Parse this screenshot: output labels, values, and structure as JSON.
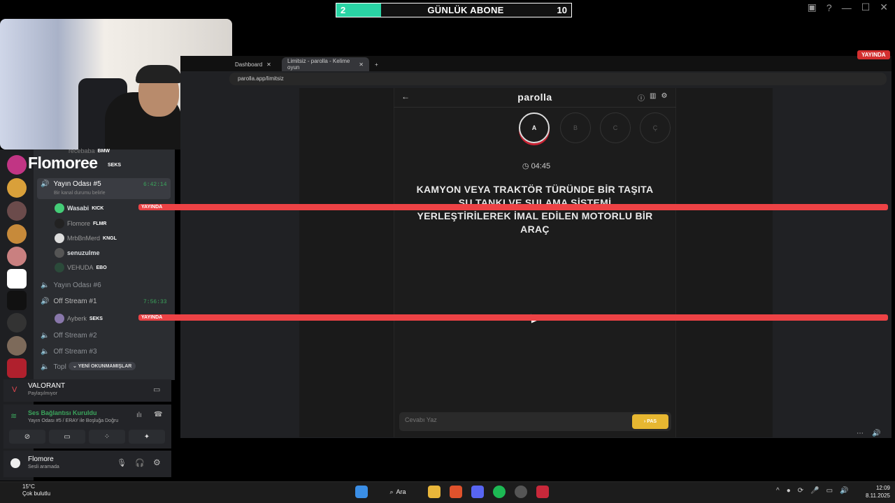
{
  "overlay": {
    "sub_count_left": "2",
    "sub_label": "GÜNLÜK ABONE",
    "sub_goal": "10",
    "sub_progress": 0.2
  },
  "browser": {
    "tabs": [
      {
        "label": "Dashboard"
      },
      {
        "label": "Limitsiz - parolla - Kelime oyun"
      }
    ],
    "url": "parolla.app/limitsiz",
    "live_badge": "YAYINDA"
  },
  "game": {
    "logo": "parolla",
    "letters": [
      "A",
      "B",
      "C",
      "Ç"
    ],
    "active_letter": "A",
    "timer": "04:45",
    "question": "KAMYON VEYA TRAKTÖR TÜRÜNDE BİR TAŞITA SU TANKI VE SULAMA SİSTEMİ YERLEŞTİRİLEREK İMAL EDİLEN MOTORLU BİR ARAÇ",
    "answer_placeholder": "Cevabı Yaz",
    "pass_label": "PAS"
  },
  "discord": {
    "server_name": "Flomoree",
    "top_users": [
      {
        "name": "recebaba",
        "tag": "BMW"
      },
      {
        "tag": "SEKS"
      }
    ],
    "channels": [
      {
        "name": "Yayın Odası #5",
        "time": "6:42:14",
        "status": "Bir kanal durumu belirle"
      },
      {
        "name": "Yayın Odası #6"
      },
      {
        "name": "Off Stream #1",
        "time": "7:56:33"
      },
      {
        "name": "Off Stream #2"
      },
      {
        "name": "Off Stream #3"
      },
      {
        "name": "Topl"
      }
    ],
    "room5_users": [
      {
        "name": "Wasabi",
        "tag": "KICK",
        "live": "YAYINDA"
      },
      {
        "name": "Flomore",
        "tag": "FLMR"
      },
      {
        "name": "MrbBnMerd",
        "tag": "KNGL"
      },
      {
        "name": "senuzulme",
        "tag": ""
      },
      {
        "name": "VEHUDA",
        "tag": "EBO"
      }
    ],
    "off1_users": [
      {
        "name": "Ayberk",
        "tag": "SEKS",
        "live": "YAYINDA"
      }
    ],
    "unread_label": "YENİ OKUNMAMIŞLAR",
    "activity": {
      "game": "VALORANT",
      "status": "Paylaşılmıyor"
    },
    "voice": {
      "title": "Ses Bağlantısı Kuruldu",
      "detail": "Yayın Odası #5 / ERAY ile Boşluğa Doğru"
    },
    "me": {
      "name": "Flomore",
      "status": "Sesli aramada"
    }
  },
  "taskbar": {
    "temp": "15°C",
    "weather": "Çok bulutlu",
    "search_label": "Ara",
    "time": "12:09",
    "date": "8.11.2025"
  },
  "colors": {
    "accent_teal": "#2ad4a5",
    "live_red": "#ed4245",
    "pass_yellow": "#e7b731",
    "voice_green": "#3ba55c"
  }
}
